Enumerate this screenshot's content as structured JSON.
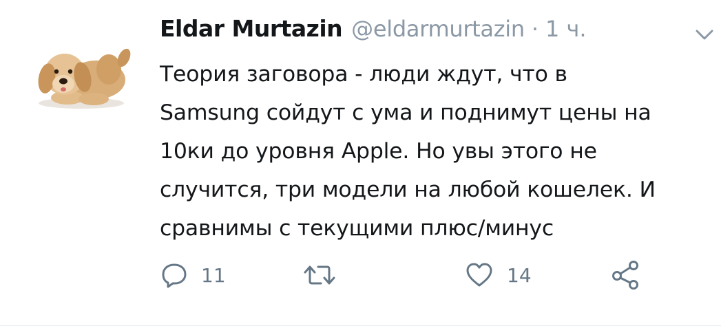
{
  "tweet": {
    "author": {
      "name": "Eldar Murtazin",
      "handle": "@eldarmurtazin",
      "separator": "·",
      "time": "1 ч."
    },
    "text_lines": [
      "Теория заговора - люди ждут, что в",
      "Samsung сойдут с ума и поднимут цены на",
      "10ки до уровня Apple. Но увы этого не",
      "случится, три модели на любой кошелек. И",
      "сравнимы с текущими плюс/минус"
    ],
    "actions": {
      "reply_count": "11",
      "retweet_count": "",
      "like_count": "14"
    },
    "icons": {
      "avatar": "plush-dog-avatar",
      "menu": "chevron-down-icon",
      "reply": "reply-icon",
      "retweet": "retweet-icon",
      "like": "heart-icon",
      "share": "share-icon"
    },
    "colors": {
      "text": "#14171a",
      "secondary": "#8b98a5",
      "icon": "#657786",
      "divider": "#e6ecf0"
    }
  }
}
